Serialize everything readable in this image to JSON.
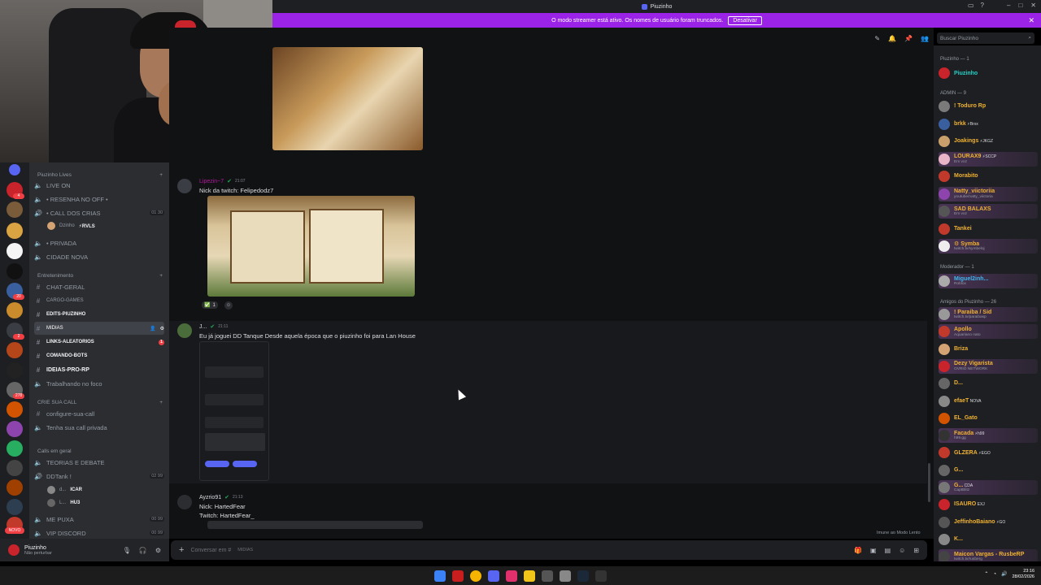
{
  "window": {
    "title": "Piuzinho"
  },
  "banner": {
    "text": "O modo streamer está ativo. Os nomes de usuário foram truncados.",
    "button": "Desativar"
  },
  "search": {
    "placeholder": "Buscar Piuzinho"
  },
  "channels": {
    "cat_lives": "Piuzinho Lives",
    "live_on": "LIVE ON",
    "resenha": "• RESENHA NO OFF •",
    "call_dos_crias": "• CALL DOS CRIAS",
    "call_dos_crias_count": "01 30",
    "call_user": "Dzinho",
    "call_user_tag": "⚡RVLS",
    "privada": "• PRIVADA",
    "cidade_nova": "CIDADE NOVA",
    "cat_entretenimento": "Entretenimento",
    "chat_geral": "CHAT-GERAL",
    "cargo_games": "CARGO-GAMES",
    "edits": "EDITS-PIUZINHO",
    "midias": "MIDIAS",
    "links": "LINKS-ALEATORIOS",
    "links_badge": "1",
    "comando_bots": "COMANDO-BOTS",
    "ideias": "IDEIAS-PRO-RP",
    "trabalhando": "Trabalhando no foco",
    "cat_crie": "CRIE SUA CALL",
    "configure": "configure-sua-call",
    "tenha": "Tenha sua call privada",
    "cat_calls": "Calls em geral",
    "teorias": "TEORIAS E DEBATE",
    "ddtank": "DDTank !",
    "ddtank_count": "02 99",
    "dd_user1": "d...",
    "dd_user1_tag": "ICAR",
    "dd_user2": "L...",
    "dd_user2_tag": "HU3",
    "me_puxa": "ME PUXA",
    "me_puxa_count": "00 99",
    "vip": "VIP DISCORD",
    "vip_count": "00 99"
  },
  "servers": {
    "badges": [
      "4",
      "20",
      "2",
      "278"
    ],
    "novo": "NOVO"
  },
  "userpanel": {
    "name": "Piuzinho",
    "status": "Não perturbar"
  },
  "messages": [
    {
      "author": "Lipezin~7",
      "time": "21:07",
      "text": "Nick da twitch: Felipedodz7",
      "reaction_count": "1",
      "color": "#b5179e"
    },
    {
      "author": "J...",
      "time": "21:11",
      "text": "Eu já joguei DD Tanque Desde aquela época que o piuzinho foi para Lan House",
      "color": "#dbdee1"
    },
    {
      "author": "Ayzrio91",
      "time": "21:13",
      "text": "Nick: HartedFear",
      "text2": "Twitch: HartedFear_",
      "color": "#dbdee1"
    }
  ],
  "composer": {
    "placeholder": "Conversar em #",
    "channel": "MIDIAS"
  },
  "slowmode": "Imune ao Modo Lento",
  "members": {
    "cat_owner": "Piuzinho — 1",
    "owner": "Piuzinho",
    "cat_admin": "ADMIN — 9",
    "admins": [
      {
        "name": "! Toduro Rp",
        "tag": "",
        "sub": "",
        "color": "#f0b232"
      },
      {
        "name": "brkk",
        "tag": "⚡Brxx",
        "sub": "",
        "color": "#f0b232"
      },
      {
        "name": "Joakings",
        "tag": "⚡JKGZ",
        "sub": "",
        "color": "#f0b232"
      },
      {
        "name": "LOURAX9",
        "tag": "⚡SCCP",
        "sub": "Em voz",
        "color": "#f0b232"
      },
      {
        "name": "Morabito",
        "tag": "",
        "sub": "",
        "color": "#f0b232"
      },
      {
        "name": "Natty_viictoriia",
        "tag": "",
        "sub": "youtube/natty_viictoria",
        "color": "#f0b232"
      },
      {
        "name": "SAD BALAXS",
        "tag": "",
        "sub": "Em voz",
        "color": "#f0b232"
      },
      {
        "name": "Tankei",
        "tag": "",
        "sub": "",
        "color": "#f0b232"
      },
      {
        "name": "⚙ Symba",
        "tag": "",
        "sub": "twitch.tv/symbeloj",
        "color": "#f0b232"
      }
    ],
    "cat_mod": "Moderador — 1",
    "mod": {
      "name": "Miguel2inh...",
      "sub": "Roblox",
      "color": "#3fb6f0"
    },
    "cat_amigos": "Amigos do Piuzinho — 26",
    "amigos": [
      {
        "name": "! Paraiba / Sid",
        "tag": "",
        "sub": "twitch.tv/paraibasp",
        "color": "#f0b232"
      },
      {
        "name": "Apollo",
        "tag": "",
        "sub": "Aquariano nato",
        "color": "#f0b232"
      },
      {
        "name": "Briza",
        "tag": "",
        "sub": "",
        "color": "#f0b232"
      },
      {
        "name": "Dezy Vigarista",
        "tag": "",
        "sub": "OVRIO NETWORK",
        "color": "#f0b232"
      },
      {
        "name": "D...",
        "tag": "",
        "sub": "",
        "color": "#f0b232"
      },
      {
        "name": "efaeT",
        "tag": "NOVA",
        "sub": "",
        "color": "#f0b232"
      },
      {
        "name": "EL_Gato",
        "tag": "",
        "sub": "",
        "color": "#f0b232"
      },
      {
        "name": "Facada",
        "tag": "⚡h99",
        "sub": "h99.gg",
        "color": "#f0b232"
      },
      {
        "name": "GLZERA",
        "tag": "⚡EGO",
        "sub": "",
        "color": "#f0b232"
      },
      {
        "name": "G...",
        "tag": "",
        "sub": "",
        "color": "#f0b232"
      },
      {
        "name": "G...",
        "tag": "CDA",
        "sub": "CaptBlitz",
        "color": "#f0b232"
      },
      {
        "name": "ISAURO",
        "tag": "EXJ",
        "sub": "",
        "color": "#f0b232"
      },
      {
        "name": "JeffinhoBaiano",
        "tag": "⚡GO",
        "sub": "",
        "color": "#f0b232"
      },
      {
        "name": "K...",
        "tag": "",
        "sub": "",
        "color": "#f0b232"
      },
      {
        "name": "Maicon Vargas - RusbeRP",
        "tag": "",
        "sub": "twitch.tv/rusberg",
        "color": "#f0b232"
      }
    ]
  },
  "taskbar": {
    "time": "23:16",
    "date": "28/02/2026"
  },
  "colors": {
    "accent": "#5865f2",
    "banner": "#9b23e8",
    "dnd": "#f23f43",
    "online": "#23a55a"
  }
}
